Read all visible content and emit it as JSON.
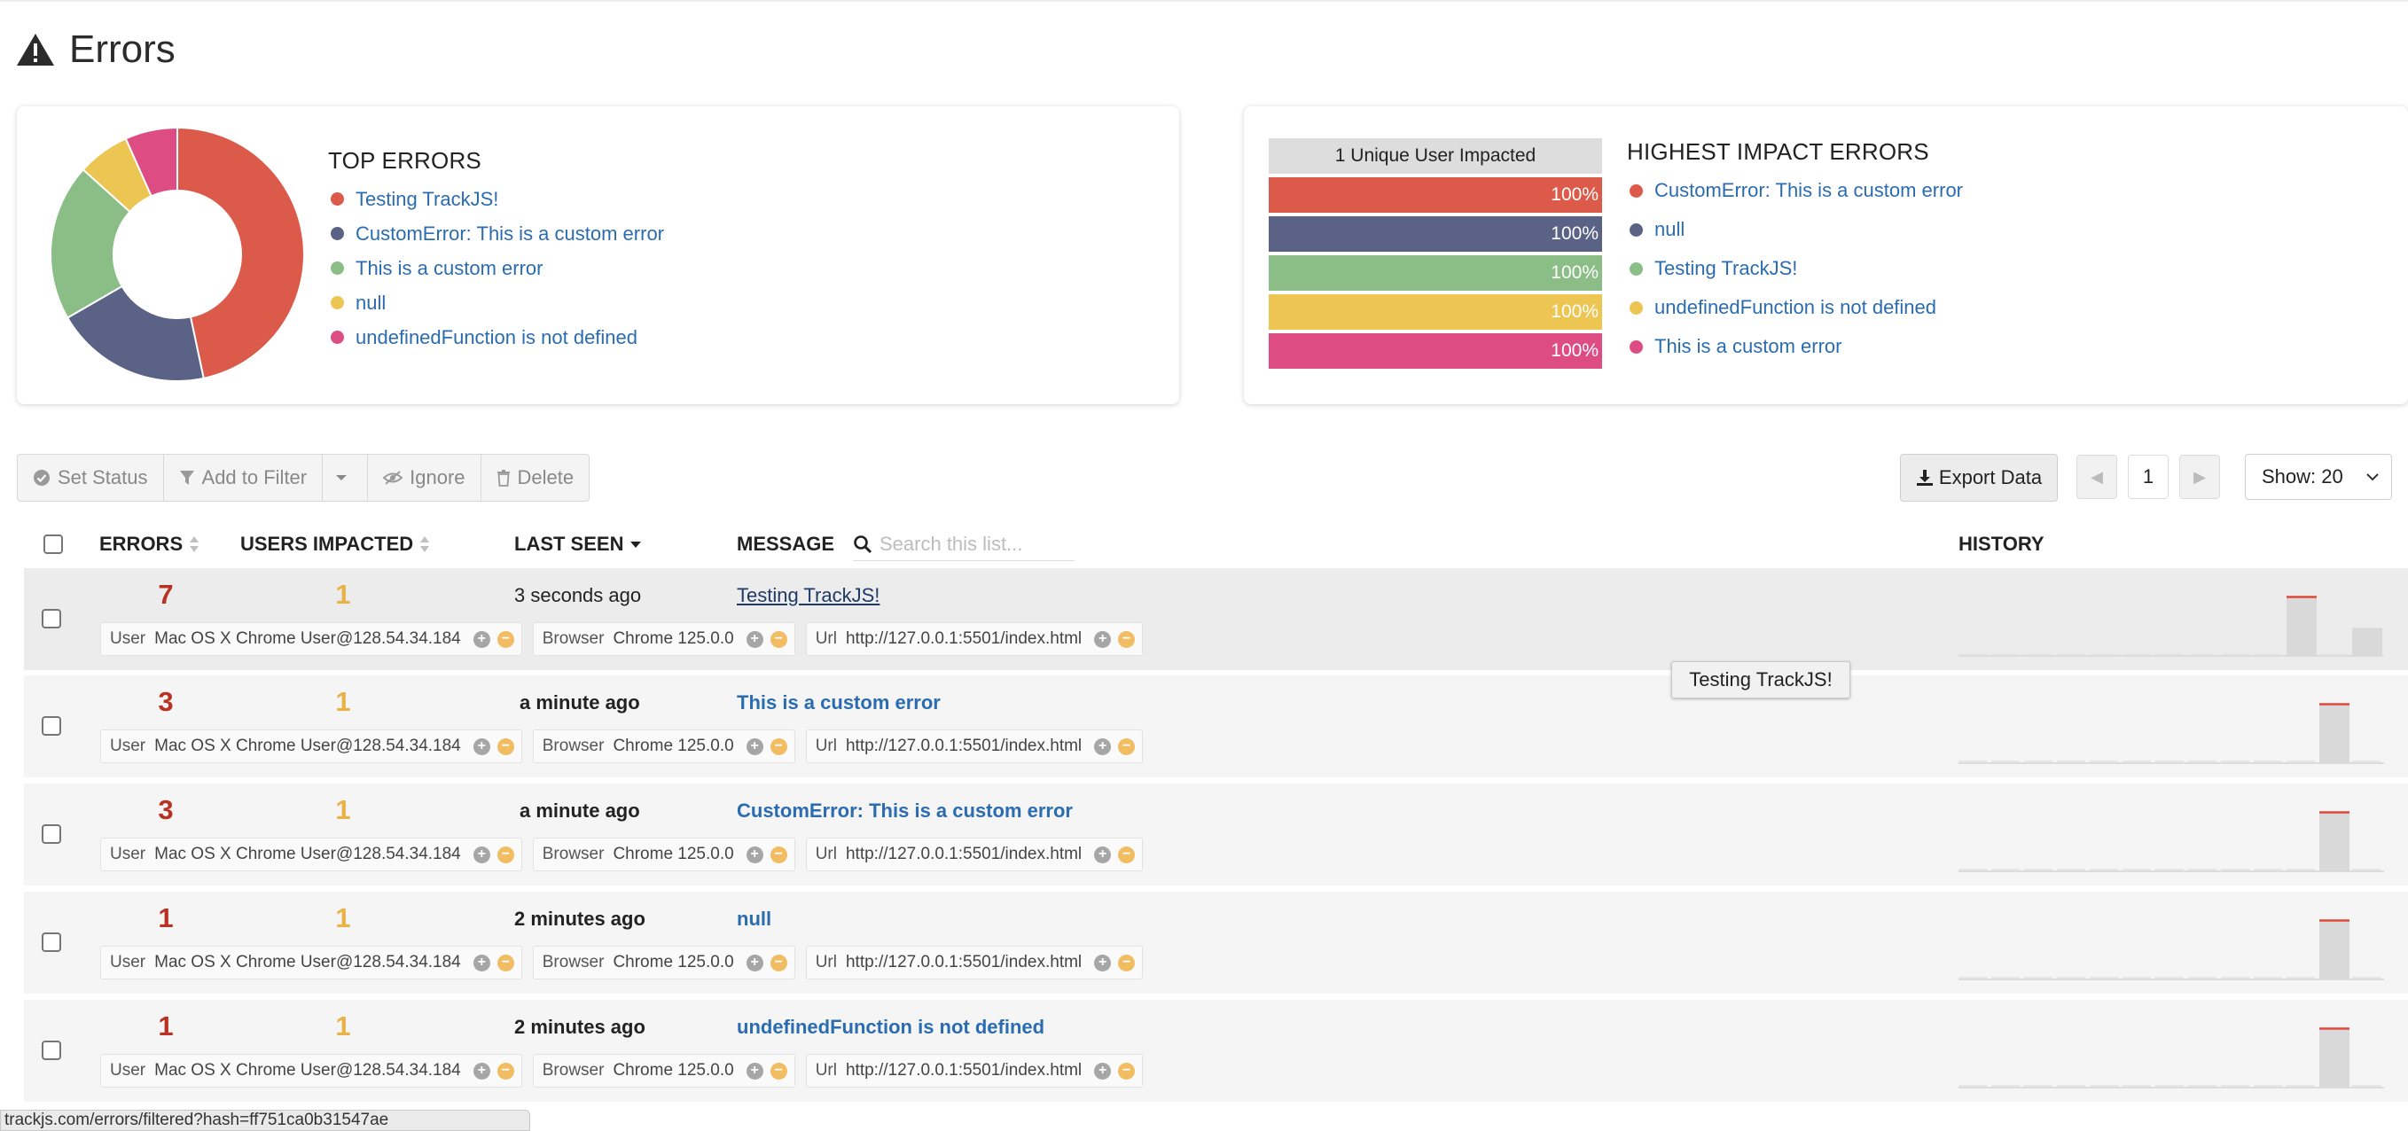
{
  "header": {
    "title": "Errors"
  },
  "colors": {
    "red": "#dc5a4a",
    "navy": "#5a6285",
    "green": "#8bbe86",
    "yellow": "#ecc552",
    "pink": "#dd4d84",
    "link": "#2b6cb0"
  },
  "top_errors": {
    "title": "TOP ERRORS",
    "items": [
      {
        "label": "Testing TrackJS!"
      },
      {
        "label": "CustomError: This is a custom error"
      },
      {
        "label": "This is a custom error"
      },
      {
        "label": "null"
      },
      {
        "label": "undefinedFunction is not defined"
      }
    ],
    "chart_data": {
      "type": "pie",
      "categories": [
        "Testing TrackJS!",
        "CustomError: This is a custom error",
        "This is a custom error",
        "null",
        "undefinedFunction is not defined"
      ],
      "values": [
        7,
        3,
        3,
        1,
        1
      ]
    }
  },
  "impact": {
    "header": "1 Unique User Impacted",
    "title": "HIGHEST IMPACT ERRORS",
    "bars": [
      {
        "label": "100%",
        "value": 1.0
      },
      {
        "label": "100%",
        "value": 1.0
      },
      {
        "label": "100%",
        "value": 1.0
      },
      {
        "label": "100%",
        "value": 1.0
      },
      {
        "label": "100%",
        "value": 1.0
      }
    ],
    "items": [
      {
        "label": "CustomError: This is a custom error"
      },
      {
        "label": "null"
      },
      {
        "label": "Testing TrackJS!"
      },
      {
        "label": "undefinedFunction is not defined"
      },
      {
        "label": "This is a custom error"
      }
    ]
  },
  "toolbar": {
    "set_status": "Set Status",
    "add_to_filter": "Add to Filter",
    "ignore": "Ignore",
    "delete": "Delete",
    "export": "Export Data",
    "page": "1",
    "show": "Show: 20"
  },
  "table": {
    "headers": {
      "errors": "ERRORS",
      "users": "USERS IMPACTED",
      "last_seen": "LAST SEEN",
      "message": "MESSAGE",
      "history": "HISTORY"
    },
    "search_placeholder": "Search this list...",
    "rows": [
      {
        "errors": "7",
        "users": "1",
        "last_seen": "3 seconds ago",
        "message": "Testing TrackJS!",
        "user_k": "User",
        "user_v": "Mac OS X Chrome User@128.54.34.184",
        "browser_k": "Browser",
        "browser_v": "Chrome 125.0.0",
        "url_k": "Url",
        "url_v": "http://127.0.0.1:5501/index.html"
      },
      {
        "errors": "3",
        "users": "1",
        "last_seen": "a minute ago",
        "message": "This is a custom error",
        "user_k": "User",
        "user_v": "Mac OS X Chrome User@128.54.34.184",
        "browser_k": "Browser",
        "browser_v": "Chrome 125.0.0",
        "url_k": "Url",
        "url_v": "http://127.0.0.1:5501/index.html"
      },
      {
        "errors": "3",
        "users": "1",
        "last_seen": "a minute ago",
        "message": "CustomError: This is a custom error",
        "user_k": "User",
        "user_v": "Mac OS X Chrome User@128.54.34.184",
        "browser_k": "Browser",
        "browser_v": "Chrome 125.0.0",
        "url_k": "Url",
        "url_v": "http://127.0.0.1:5501/index.html"
      },
      {
        "errors": "1",
        "users": "1",
        "last_seen": "2 minutes ago",
        "message": "null",
        "user_k": "User",
        "user_v": "Mac OS X Chrome User@128.54.34.184",
        "browser_k": "Browser",
        "browser_v": "Chrome 125.0.0",
        "url_k": "Url",
        "url_v": "http://127.0.0.1:5501/index.html"
      },
      {
        "errors": "1",
        "users": "1",
        "last_seen": "2 minutes ago",
        "message": "undefinedFunction is not defined",
        "user_k": "User",
        "user_v": "Mac OS X Chrome User@128.54.34.184",
        "browser_k": "Browser",
        "browser_v": "Chrome 125.0.0",
        "url_k": "Url",
        "url_v": "http://127.0.0.1:5501/index.html"
      }
    ]
  },
  "tooltip": "Testing TrackJS!",
  "statusbar": "trackjs.com/errors/filtered?hash=ff751ca0b31547ae"
}
